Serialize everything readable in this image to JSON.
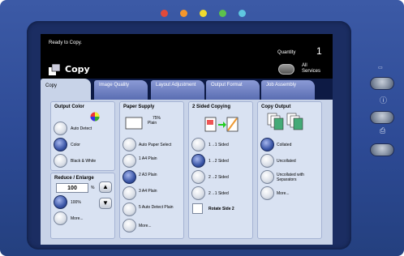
{
  "status": {
    "message": "Ready to Copy.",
    "quantity_label": "Quantity",
    "quantity_value": "1"
  },
  "header": {
    "title": "Copy",
    "all_services": "All Services"
  },
  "tabs": [
    {
      "label": "Copy"
    },
    {
      "label": "Image Quality"
    },
    {
      "label": "Layout Adjustment"
    },
    {
      "label": "Output Format"
    },
    {
      "label": "Job Assembly"
    }
  ],
  "output_color": {
    "title": "Output Color",
    "options": [
      "Auto Detect",
      "Color",
      "Black & White"
    ],
    "selected": "Color"
  },
  "reduce_enlarge": {
    "title": "Reduce / Enlarge",
    "value": "100",
    "unit": "%",
    "options": [
      "100%",
      "More..."
    ],
    "selected": "100%"
  },
  "paper_supply": {
    "title": "Paper Supply",
    "preview_size": "75%",
    "preview_type": "Plain",
    "options": [
      "Auto Paper Select",
      "1 A4 Plain",
      "2 A3 Plain",
      "3 A4 Plain",
      "5 Auto Detect Plain",
      "More..."
    ],
    "selected": "2 A3 Plain"
  },
  "two_sided": {
    "title": "2 Sided Copying",
    "options": [
      "1→1 Sided",
      "1→2 Sided",
      "2→2 Sided",
      "2→1 Sided"
    ],
    "selected": "1→2 Sided",
    "rotate": "Rotate Side 2"
  },
  "copy_output": {
    "title": "Copy Output",
    "options": [
      "Collated",
      "Uncollated",
      "Uncollated with Separators",
      "More..."
    ],
    "selected": "Collated"
  },
  "colors": {
    "accent": "#3a55a6",
    "bezel": "#2d4a95",
    "screen_bg": "#c8d3e8"
  }
}
